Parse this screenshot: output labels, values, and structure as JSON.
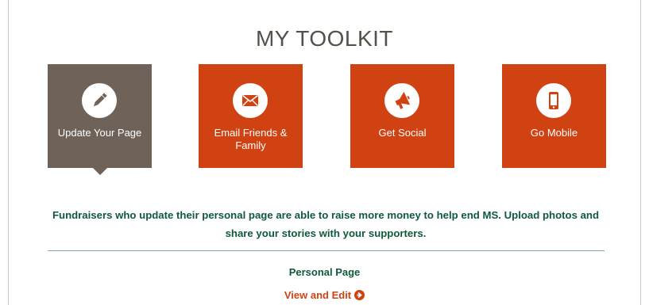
{
  "page": {
    "title": "MY TOOLKIT"
  },
  "tiles": [
    {
      "label": "Update Your Page",
      "icon": "pencil-icon",
      "active": true
    },
    {
      "label": "Email Friends & Family",
      "icon": "envelope-icon",
      "active": false
    },
    {
      "label": "Get Social",
      "icon": "megaphone-icon",
      "active": false
    },
    {
      "label": "Go Mobile",
      "icon": "smartphone-icon",
      "active": false
    }
  ],
  "content": {
    "description": "Fundraisers who update their personal page are able to raise more money to help end MS. Upload photos and share your stories with your supporters.",
    "section_label": "Personal Page",
    "link_label": "View and Edit"
  },
  "colors": {
    "accent": "#d04212",
    "active_tile": "#6f6258",
    "text_green": "#0f5a3a",
    "title_gray": "#555049"
  }
}
